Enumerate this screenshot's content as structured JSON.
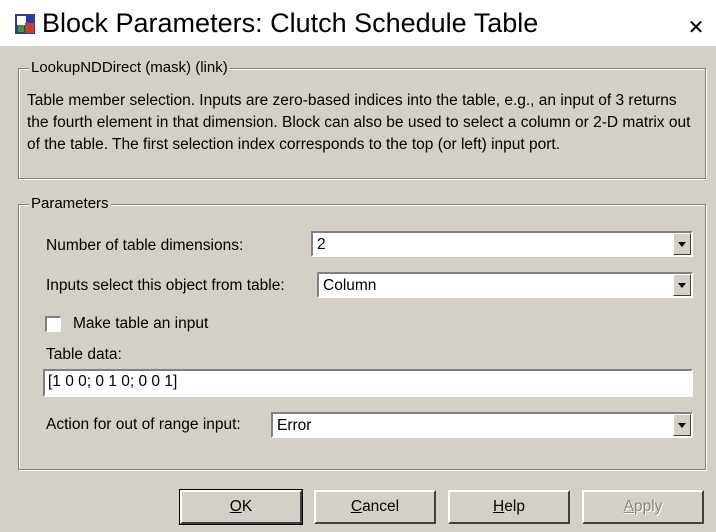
{
  "window": {
    "title": "Block Parameters: Clutch Schedule Table",
    "close_glyph": "✕"
  },
  "mask_group": {
    "legend": "LookupNDDirect (mask) (link)",
    "description": "Table member selection.  Inputs are zero-based indices into the table, e.g., an input of 3 returns the fourth element in that dimension.  Block can also be used to select a column or 2-D matrix out of the table.  The first selection index corresponds to the top (or left) input port."
  },
  "parameters": {
    "legend": "Parameters",
    "num_dims_label": "Number of table dimensions:",
    "num_dims_value": "2",
    "inputs_select_label": "Inputs select this object from table:",
    "inputs_select_value": "Column",
    "make_input_label": "Make table an input",
    "make_input_checked": false,
    "table_data_label": "Table data:",
    "table_data_value": "[1 0 0; 0 1 0; 0 0 1]",
    "out_of_range_label": "Action for out of range input:",
    "out_of_range_value": "Error"
  },
  "buttons": {
    "ok_mnemonic": "O",
    "ok_rest": "K",
    "cancel_mnemonic": "C",
    "cancel_rest": "ancel",
    "help_mnemonic": "H",
    "help_rest": "elp",
    "apply_mnemonic": "A",
    "apply_rest": "pply"
  },
  "colors": {
    "dialog_bg": "#d4d0c8",
    "title_bg": "#ffffff"
  },
  "icons": {
    "app": "simulink-block-icon",
    "close": "close-icon",
    "dropdown": "chevron-down-icon"
  }
}
